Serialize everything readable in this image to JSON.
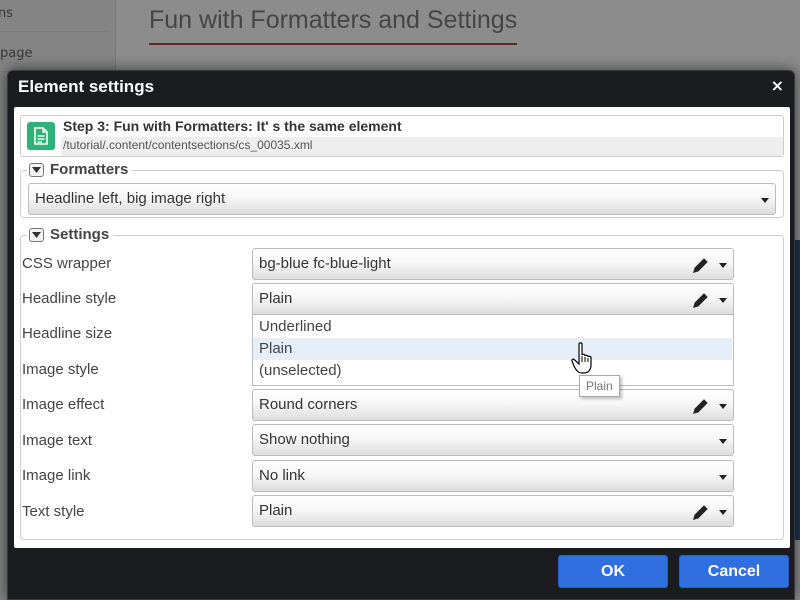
{
  "background": {
    "page_title": "Fun with Formatters and Settings",
    "sidebar_items": [
      "ns",
      "page"
    ]
  },
  "dialog": {
    "title": "Element settings",
    "close_label": "×",
    "element": {
      "title": "Step 3: Fun with Formatters: It' s  the same element",
      "path": "/tutorial/.content/contentsections/cs_00035.xml"
    },
    "formatters": {
      "legend": "Formatters",
      "selected": "Headline left, big image right"
    },
    "settings": {
      "legend": "Settings",
      "rows": [
        {
          "label": "CSS wrapper",
          "value": "bg-blue fc-blue-light",
          "has_pencil": true
        },
        {
          "label": "Headline style",
          "value": "Plain",
          "has_pencil": true,
          "open": true
        },
        {
          "label": "Headline size",
          "value": ""
        },
        {
          "label": "Image style",
          "value": ""
        },
        {
          "label": "Image effect",
          "value": "Round corners",
          "has_pencil": true
        },
        {
          "label": "Image text",
          "value": "Show nothing"
        },
        {
          "label": "Image link",
          "value": "No link"
        },
        {
          "label": "Text style",
          "value": "Plain",
          "has_pencil": true
        }
      ],
      "dropdown_options": [
        "Underlined",
        "Plain",
        "(unselected)"
      ],
      "highlighted_option": "Plain",
      "tooltip": "Plain"
    },
    "buttons": {
      "ok": "OK",
      "cancel": "Cancel"
    }
  },
  "colors": {
    "accent_blue": "#2f6fe0",
    "title_underline": "#b5474d",
    "doc_icon_green": "#2bb37a",
    "dialog_frame": "#1b1c20",
    "highlight": "#e5eef9"
  }
}
